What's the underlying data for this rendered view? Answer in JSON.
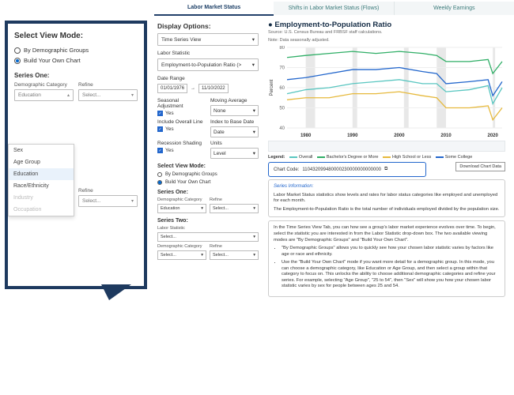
{
  "modal": {
    "title": "Select View Mode:",
    "radio_demo": "By Demographic Groups",
    "radio_build": "Build Your Own Chart",
    "series_one": "Series One:",
    "demo_cat": "Demographic Category",
    "refine": "Refine",
    "demo_val": "Education",
    "sel_placeholder": "Select...",
    "series_two": "Series Two:",
    "dd": {
      "sex": "Sex",
      "age": "Age Group",
      "edu": "Education",
      "race": "Race/Ethnicity",
      "ind": "Industry",
      "occ": "Occupation"
    }
  },
  "tabs": {
    "t1": "Labor Market Status",
    "t2": "Shifts in Labor Market Status (Flows)",
    "t3": "Weekly Earnings"
  },
  "panel": {
    "display_options": "Display Options:",
    "view_sel": "Time Series View",
    "labor_stat": "Labor Statistic",
    "labor_val": "Employment-to-Population Ratio (>",
    "date_range": "Date Range",
    "date_from": "01/01/1976",
    "date_to": "11/10/2022",
    "seasonal": "Seasonal Adjustment",
    "movavg": "Moving Average",
    "yes": "Yes",
    "none": "None",
    "include_overall": "Include Overall Line",
    "index_base": "Index to Base Date",
    "date": "Date",
    "recession": "Recession Shading",
    "units": "Units",
    "level": "Level",
    "view_mode": "Select View Mode:",
    "r1": "By Demographic Groups",
    "r2": "Build Your Own Chart",
    "s1": "Series One:",
    "s2": "Series Two:",
    "demo": "Demographic Category",
    "refine": "Refine",
    "edu": "Education",
    "sel": "Select...",
    "lstat": "Labor Statistic"
  },
  "chart": {
    "title": "Employment-to-Population Ratio",
    "source": "Source: U.S. Census Bureau and FRBSF staff calculations.",
    "note": "Note: Data seasonally adjusted.",
    "ylabel": "Percent",
    "legend_title": "Legend:",
    "lg1": "Overall",
    "lg2": "Bachelor's Degree or More",
    "lg3": "High School or Less",
    "lg4": "Some College",
    "code_label": "Chart Code:",
    "code": "110432099480000230000000000000",
    "dl": "Download Chart Data"
  },
  "info1": {
    "title": "Series Information:",
    "p1": "Labor Market Status statistics show levels and rates for labor status categories like employed and unemployed for each month.",
    "p2": "The Employment-to-Population Ratio is the total number of individuals employed divided by the population size."
  },
  "info2": {
    "p1": "In the Time Series View Tab, you can how see a group's labor market experience evolves over time. To begin, select the statistic you are interested in from the Labor Statistic drop-down box. The two available viewing modes are \"By Demographic Groups\" and \"Build Your Own Chart\".",
    "b1": "\"By Demographic Groups\" allows you to quickly see how your chosen labor statistic varies by factors like age or race and ethnicity.",
    "b2": "Use the \"Build Your Own Chart\" mode if you want more detail for a demographic group. In this mode, you can choose a demographic category, like Education or Age Group, and then select a group within that category to focus on. This unlocks the ability to choose additional demographic categories and refine your series. For example, selecting \"Age Group\", \"25 to 54\", then \"Sex\" will show you how your chosen labor statistic varies by sex for people between ages 25 and 54."
  },
  "chart_data": {
    "type": "line",
    "ylabel": "Percent",
    "ylim": [
      40,
      80
    ],
    "x": [
      1976,
      1980,
      1985,
      1990,
      1995,
      2000,
      2005,
      2008,
      2010,
      2015,
      2019,
      2020,
      2022
    ],
    "ticks": [
      1980,
      1990,
      2000,
      2010,
      2020
    ],
    "series": [
      {
        "name": "Bachelor's Degree or More",
        "color": "#2fae66",
        "values": [
          75,
          76,
          77,
          78,
          77,
          78,
          77,
          76,
          73,
          73,
          74,
          67,
          73
        ]
      },
      {
        "name": "Some College",
        "color": "#2266cc",
        "values": [
          64,
          65,
          67,
          69,
          69,
          70,
          68,
          67,
          62,
          63,
          64,
          56,
          63
        ]
      },
      {
        "name": "Overall",
        "color": "#59c6c0",
        "values": [
          57,
          59,
          60,
          62,
          63,
          64,
          62,
          62,
          58,
          59,
          61,
          52,
          60
        ]
      },
      {
        "name": "High School or Less",
        "color": "#e6b93c",
        "values": [
          54,
          55,
          55,
          57,
          57,
          58,
          56,
          55,
          50,
          50,
          51,
          44,
          50
        ]
      }
    ],
    "recessions": [
      [
        1980,
        1982
      ],
      [
        1990,
        1991
      ],
      [
        2001,
        2002
      ],
      [
        2008,
        2010
      ],
      [
        2020,
        2020.5
      ]
    ]
  }
}
